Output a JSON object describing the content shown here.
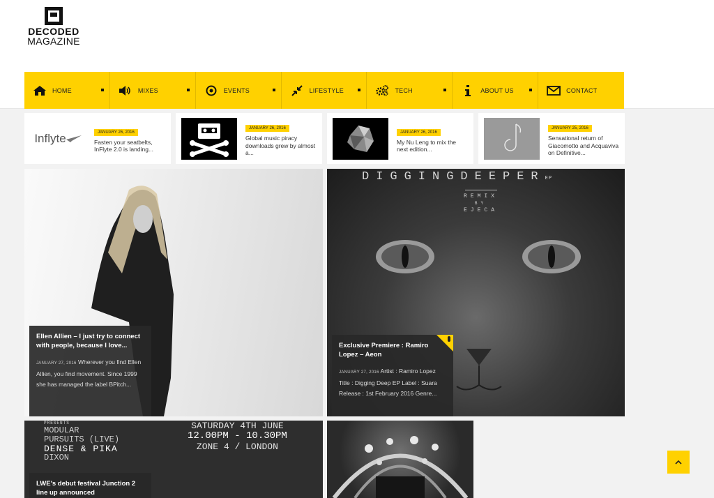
{
  "brand": {
    "line1": "DECODED",
    "line2": "MAGAZINE"
  },
  "accent_color": "#ffd100",
  "nav": {
    "items": [
      {
        "label": "HOME",
        "icon": "home-icon"
      },
      {
        "label": "MIXES",
        "icon": "speaker-icon"
      },
      {
        "label": "EVENTS",
        "icon": "target-icon"
      },
      {
        "label": "LIFESTYLE",
        "icon": "arrows-collapse-icon"
      },
      {
        "label": "TECH",
        "icon": "gears-icon"
      },
      {
        "label": "ABOUT US",
        "icon": "info-icon"
      },
      {
        "label": "CONTACT",
        "icon": "envelope-icon"
      }
    ]
  },
  "ticker": [
    {
      "thumb": "Inflyte",
      "date": "JANUARY 26, 2016",
      "title": "Fasten your seatbelts, InFlyte 2.0 is landing..."
    },
    {
      "date": "JANUARY 26, 2016",
      "title": "Global music piracy downloads grew by almost a..."
    },
    {
      "date": "JANUARY 26, 2016",
      "title": "My Nu Leng to mix the next edition..."
    },
    {
      "date": "JANUARY 25, 2016",
      "title": "Sensational return of Giacomotto and Acquaviva on Definitive..."
    }
  ],
  "features": {
    "ellen": {
      "title": "Ellen Allien – I just try to connect with people, because I love...",
      "date": "JANUARY 27, 2016",
      "excerpt": "Wherever you find Ellen Allien, you find movement. Since 1999 she has managed the label BPitch..."
    },
    "ramiro": {
      "title": "Exclusive Premiere : Ramiro Lopez – Aeon",
      "date": "JANUARY 27, 2016",
      "excerpt": "Artist : Ramiro Lopez Title : Digging Deep EP Label : Suara Release : 1st February 2016 Genre...",
      "art_heading": "DIGGINGDEEPER",
      "art_heading_suffix": "EP",
      "art_sub1": "REMIX",
      "art_sub2": "BY",
      "art_sub3": "EJECA"
    },
    "lwe": {
      "title": "LWE's debut festival Junction 2 line up announced",
      "poster_presents": "PRESENTS",
      "poster_line1": "MODULAR",
      "poster_line2": "PURSUITS (LIVE)",
      "poster_line3": "DENSE & PIKA",
      "poster_line4": "DIXON",
      "poster_date": "SATURDAY 4TH JUNE",
      "poster_time": "12.00PM - 10.30PM",
      "poster_place": "ZONE 4 / LONDON"
    }
  },
  "back_to_top": "^"
}
